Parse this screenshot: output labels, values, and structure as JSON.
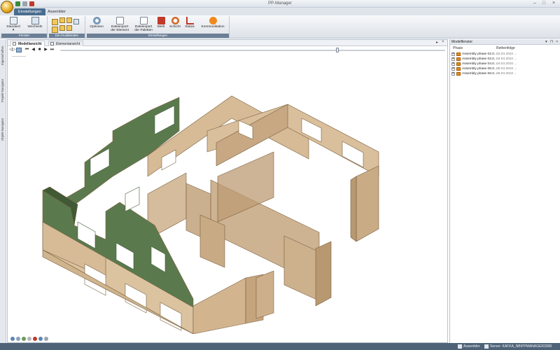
{
  "app": {
    "title": "PP-Manager"
  },
  "ribbon": {
    "tabs": [
      {
        "label": "Einstellungen"
      },
      {
        "label": "Assembler"
      }
    ],
    "groups": {
      "fenster": "Fenster",
      "ein_ausblenden": "Ein-/Ausblenden",
      "einstellungen": "Einstellungen"
    },
    "buttons": {
      "standard": "Standard",
      "wechseln": "Wechseln",
      "optionen": "Optionen",
      "dateiexport_element_1": "Dateiexport",
      "dateiexport_element_2": "der Element",
      "dateiexport_paletten_1": "Dateiexport",
      "dateiexport_paletten_2": "der Paletten",
      "werk": "Werk",
      "schicht": "Schicht",
      "status": "Status",
      "kommunikation": "Kommunikation"
    }
  },
  "sidebar": {
    "tabs": [
      "Eigenschaften",
      "Projekt-Navigator",
      "Objekt-Navigator"
    ]
  },
  "document": {
    "tabs": [
      {
        "label": "Modellansicht"
      },
      {
        "label": "Elementansicht"
      }
    ],
    "close_glyph": "×",
    "nav": {
      "first": "⏮",
      "prev": "◀",
      "stop": "■",
      "play": "▶",
      "last": "⏭",
      "slider_position": 0.72
    }
  },
  "model_colors": {
    "wood": "#d2b58f",
    "wood_dark": "#b0916a",
    "wood_edge": "#7a5f3e",
    "gable_green": "#5a7a4e",
    "gable_dark": "#3f5a35"
  },
  "panel": {
    "title": "Modellfenster",
    "ctrl": [
      "▾",
      "⊓",
      "×"
    ],
    "columns": {
      "phase": "Phase",
      "reihenfolge": "Reihenfolge"
    },
    "rows": [
      {
        "name": "Assembly phase 02.0...",
        "date": "02.03.2010 ..."
      },
      {
        "name": "Assembly phase 03.0...",
        "date": "03.03.2010 ..."
      },
      {
        "name": "Assembly phase 04.0...",
        "date": "04.03.2010 ..."
      },
      {
        "name": "Assembly phase 05.0...",
        "date": "05.03.2010 ..."
      },
      {
        "name": "Assembly phase 06.0...",
        "date": "06.03.2010 ..."
      }
    ]
  },
  "status": {
    "left": "Assembler",
    "right": "Server: KAFKA_NB\\PPMANAGER2008"
  }
}
